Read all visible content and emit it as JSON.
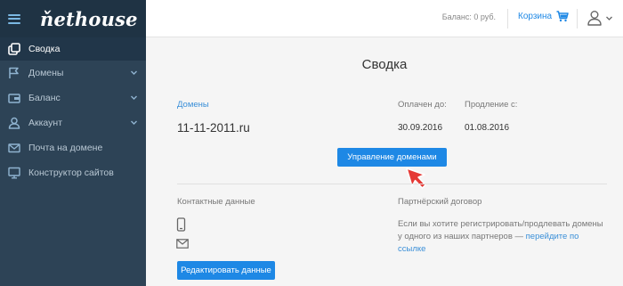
{
  "brand": {
    "logo": "ňethouse"
  },
  "sidebar": {
    "items": [
      {
        "label": "Сводка",
        "icon": "summary-icon"
      },
      {
        "label": "Домены",
        "icon": "flag-icon"
      },
      {
        "label": "Баланс",
        "icon": "wallet-icon"
      },
      {
        "label": "Аккаунт",
        "icon": "user-icon"
      },
      {
        "label": "Почта на домене",
        "icon": "mail-icon"
      },
      {
        "label": "Конструктор сайтов",
        "icon": "monitor-icon"
      }
    ]
  },
  "topbar": {
    "balance": "Баланс: 0 руб.",
    "cart_label": "Корзина"
  },
  "main": {
    "title": "Сводка",
    "domains": {
      "header_link": "Домены",
      "paid_until_label": "Оплачен до:",
      "renewal_from_label": "Продление с:",
      "domain": "11-11-2011.ru",
      "paid_until": "30.09.2016",
      "renewal_from": "01.08.2016",
      "manage_button": "Управление доменами"
    },
    "contacts": {
      "title": "Контактные данные",
      "edit_button": "Редактировать данные"
    },
    "partner": {
      "title": "Партнёрский договор",
      "text": "Если вы хотите регистрировать/продлевать домены у одного из наших партнеров — ",
      "link": "перейдите по ссылке"
    }
  },
  "colors": {
    "sidebar_bg": "#2d4356",
    "sidebar_header_bg": "#1f3344",
    "accent": "#1e88e5",
    "link": "#3a8fd8",
    "cursor": "#e53935"
  }
}
